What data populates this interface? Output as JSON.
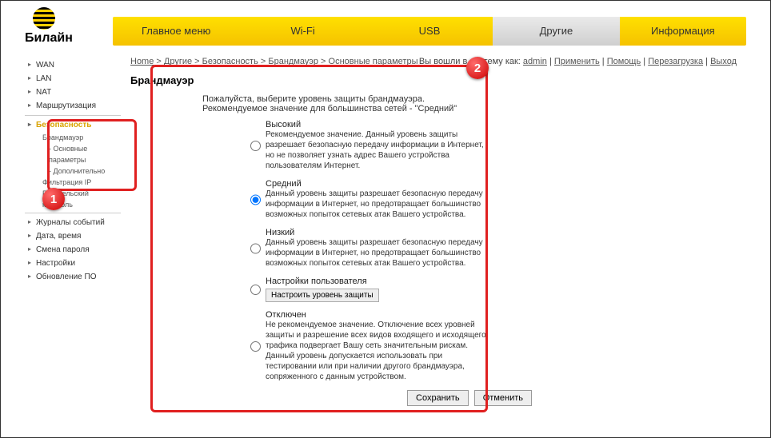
{
  "logo": "Билайн",
  "topnav": {
    "items": [
      "Главное меню",
      "Wi-Fi",
      "USB",
      "Другие",
      "Информация"
    ],
    "activeIndex": 3
  },
  "sidebar": {
    "items": [
      "WAN",
      "LAN",
      "NAT",
      "Маршрутизация"
    ],
    "security": {
      "label": "Безопасность",
      "children": {
        "firewall": "Брандмауэр",
        "basic": "- Основные параметры",
        "advanced": "- Дополнительно",
        "ipfilter": "Фильтрация IP",
        "parental": "Родительский контроль"
      }
    },
    "items2": [
      "Журналы событий",
      "Дата, время",
      "Смена пароля",
      "Настройки",
      "Обновление ПО"
    ]
  },
  "breadcrumbs": [
    "Home",
    "Другие",
    "Безопасность",
    "Брандмауэр",
    "Основные параметры"
  ],
  "headerlinks": {
    "prefix": "Вы вошли в систему как: ",
    "user": "admin",
    "links": [
      "Применить",
      "Помощь",
      "Перезагрузка",
      "Выход"
    ]
  },
  "title": "Брандмауэр",
  "intro1": "Пожалуйста, выберите уровень защиты брандмауэра.",
  "intro2": "Рекомендуемое значение для большинства сетей - \"Средний\"",
  "options": [
    {
      "label": "Высокий",
      "checked": false,
      "desc": "Рекомендуемое значение. Данный уровень защиты разрешает безопасную передачу информации в Интернет, но не позволяет узнать адрес Вашего устройства пользователям Интернет."
    },
    {
      "label": "Средний",
      "checked": true,
      "desc": "Данный уровень защиты разрешает безопасную передачу информации в Интернет, но предотвращает большинство возможных попыток сетевых атак Вашего устройства."
    },
    {
      "label": "Низкий",
      "checked": false,
      "desc": "Данный уровень защиты разрешает безопасную передачу информации в Интернет, но предотвращает большинство возможных попыток сетевых атак Вашего устройства."
    },
    {
      "label": "Настройки пользователя",
      "checked": false,
      "desc": "",
      "button": "Настроить уровень защиты"
    },
    {
      "label": "Отключен",
      "checked": false,
      "desc": "Не рекомендуемое значение. Отключение всех уровней защиты и разрешение всех видов входящего и исходящего трафика подвергает Вашу сеть значительным рискам. Данный уровень допускается использовать при тестировании или при наличии другого брандмауэра, сопряженного с данным устройством."
    }
  ],
  "actions": {
    "save": "Сохранить",
    "cancel": "Отменить"
  },
  "annotations": {
    "badge1": "1",
    "badge2": "2"
  }
}
